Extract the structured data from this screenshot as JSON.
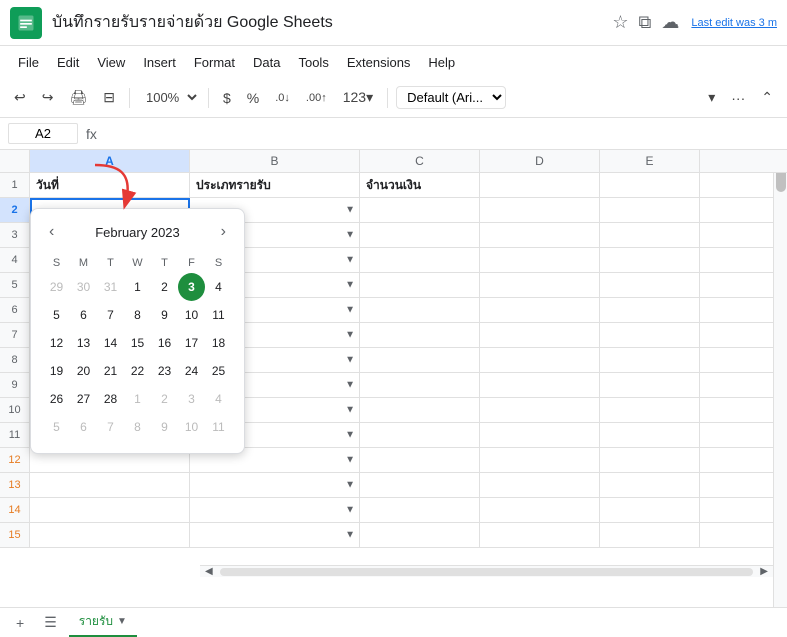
{
  "titleBar": {
    "appName": "บันทึกรายรับรายจ่ายด้วย Google Sheets",
    "lastEdit": "Last edit was 3 m",
    "icons": {
      "star": "☆",
      "copy": "⧉",
      "cloud": "☁"
    }
  },
  "menuBar": {
    "items": [
      "File",
      "Edit",
      "View",
      "Insert",
      "Format",
      "Data",
      "Tools",
      "Extensions",
      "Help"
    ]
  },
  "toolbar": {
    "undo": "↩",
    "redo": "↪",
    "print": "🖨",
    "paintFormat": "⊟",
    "zoom": "100%",
    "currency": "$",
    "percent": "%",
    "decDecrease": ".0",
    "decIncrease": ".00",
    "moreFormats": "123",
    "font": "Default (Ari...",
    "more": "..."
  },
  "formulaBar": {
    "cellRef": "A2",
    "fxLabel": "fx",
    "value": ""
  },
  "columns": {
    "rowHeader": "",
    "headers": [
      "A",
      "B",
      "C",
      "D",
      "E"
    ]
  },
  "rows": [
    {
      "num": "1",
      "numColor": "normal",
      "cells": [
        {
          "text": "วันที่",
          "type": "header",
          "hasDropdown": false
        },
        {
          "text": "ประเภทรายรับ",
          "type": "header",
          "hasDropdown": false
        },
        {
          "text": "จำนวนเงิน",
          "type": "header",
          "hasDropdown": false
        },
        {
          "text": "",
          "type": "normal",
          "hasDropdown": false
        },
        {
          "text": "",
          "type": "normal",
          "hasDropdown": false
        }
      ]
    },
    {
      "num": "2",
      "numColor": "selected",
      "cells": [
        {
          "text": "",
          "type": "selected",
          "hasDropdown": false
        },
        {
          "text": "",
          "type": "normal",
          "hasDropdown": true
        },
        {
          "text": "",
          "type": "normal",
          "hasDropdown": false
        },
        {
          "text": "",
          "type": "normal",
          "hasDropdown": false
        },
        {
          "text": "",
          "type": "normal",
          "hasDropdown": false
        }
      ]
    },
    {
      "num": "3",
      "numColor": "normal",
      "cells": [
        {
          "text": "",
          "type": "normal",
          "hasDropdown": false
        },
        {
          "text": "",
          "type": "normal",
          "hasDropdown": true
        },
        {
          "text": "",
          "type": "normal",
          "hasDropdown": false
        },
        {
          "text": "",
          "type": "normal",
          "hasDropdown": false
        },
        {
          "text": "",
          "type": "normal",
          "hasDropdown": false
        }
      ]
    },
    {
      "num": "4",
      "numColor": "normal",
      "cells": [
        {
          "text": "",
          "type": "normal",
          "hasDropdown": false
        },
        {
          "text": "",
          "type": "normal",
          "hasDropdown": true
        },
        {
          "text": "",
          "type": "normal",
          "hasDropdown": false
        },
        {
          "text": "",
          "type": "normal",
          "hasDropdown": false
        },
        {
          "text": "",
          "type": "normal",
          "hasDropdown": false
        }
      ]
    },
    {
      "num": "5",
      "numColor": "normal",
      "cells": [
        {
          "text": "",
          "type": "normal",
          "hasDropdown": false
        },
        {
          "text": "",
          "type": "normal",
          "hasDropdown": true
        },
        {
          "text": "",
          "type": "normal",
          "hasDropdown": false
        },
        {
          "text": "",
          "type": "normal",
          "hasDropdown": false
        },
        {
          "text": "",
          "type": "normal",
          "hasDropdown": false
        }
      ]
    },
    {
      "num": "6",
      "numColor": "normal",
      "cells": [
        {
          "text": "",
          "type": "normal",
          "hasDropdown": false
        },
        {
          "text": "",
          "type": "normal",
          "hasDropdown": true
        },
        {
          "text": "",
          "type": "normal",
          "hasDropdown": false
        },
        {
          "text": "",
          "type": "normal",
          "hasDropdown": false
        },
        {
          "text": "",
          "type": "normal",
          "hasDropdown": false
        }
      ]
    },
    {
      "num": "7",
      "numColor": "normal",
      "cells": [
        {
          "text": "",
          "type": "normal",
          "hasDropdown": false
        },
        {
          "text": "",
          "type": "normal",
          "hasDropdown": true
        },
        {
          "text": "",
          "type": "normal",
          "hasDropdown": false
        },
        {
          "text": "",
          "type": "normal",
          "hasDropdown": false
        },
        {
          "text": "",
          "type": "normal",
          "hasDropdown": false
        }
      ]
    },
    {
      "num": "8",
      "numColor": "normal",
      "cells": [
        {
          "text": "",
          "type": "normal",
          "hasDropdown": false
        },
        {
          "text": "",
          "type": "normal",
          "hasDropdown": true
        },
        {
          "text": "",
          "type": "normal",
          "hasDropdown": false
        },
        {
          "text": "",
          "type": "normal",
          "hasDropdown": false
        },
        {
          "text": "",
          "type": "normal",
          "hasDropdown": false
        }
      ]
    },
    {
      "num": "9",
      "numColor": "normal",
      "cells": [
        {
          "text": "",
          "type": "normal",
          "hasDropdown": false
        },
        {
          "text": "",
          "type": "normal",
          "hasDropdown": true
        },
        {
          "text": "",
          "type": "normal",
          "hasDropdown": false
        },
        {
          "text": "",
          "type": "normal",
          "hasDropdown": false
        },
        {
          "text": "",
          "type": "normal",
          "hasDropdown": false
        }
      ]
    },
    {
      "num": "10",
      "numColor": "normal",
      "cells": [
        {
          "text": "",
          "type": "normal",
          "hasDropdown": false
        },
        {
          "text": "",
          "type": "normal",
          "hasDropdown": true
        },
        {
          "text": "",
          "type": "normal",
          "hasDropdown": false
        },
        {
          "text": "",
          "type": "normal",
          "hasDropdown": false
        },
        {
          "text": "",
          "type": "normal",
          "hasDropdown": false
        }
      ]
    },
    {
      "num": "11",
      "numColor": "normal",
      "cells": [
        {
          "text": "",
          "type": "normal",
          "hasDropdown": false
        },
        {
          "text": "",
          "type": "normal",
          "hasDropdown": true
        },
        {
          "text": "",
          "type": "normal",
          "hasDropdown": false
        },
        {
          "text": "",
          "type": "normal",
          "hasDropdown": false
        },
        {
          "text": "",
          "type": "normal",
          "hasDropdown": false
        }
      ]
    },
    {
      "num": "12",
      "numColor": "orange",
      "cells": [
        {
          "text": "",
          "type": "normal",
          "hasDropdown": false
        },
        {
          "text": "",
          "type": "normal",
          "hasDropdown": true
        },
        {
          "text": "",
          "type": "normal",
          "hasDropdown": false
        },
        {
          "text": "",
          "type": "normal",
          "hasDropdown": false
        },
        {
          "text": "",
          "type": "normal",
          "hasDropdown": false
        }
      ]
    },
    {
      "num": "13",
      "numColor": "orange",
      "cells": [
        {
          "text": "",
          "type": "normal",
          "hasDropdown": false
        },
        {
          "text": "",
          "type": "normal",
          "hasDropdown": true
        },
        {
          "text": "",
          "type": "normal",
          "hasDropdown": false
        },
        {
          "text": "",
          "type": "normal",
          "hasDropdown": false
        },
        {
          "text": "",
          "type": "normal",
          "hasDropdown": false
        }
      ]
    },
    {
      "num": "14",
      "numColor": "orange",
      "cells": [
        {
          "text": "",
          "type": "normal",
          "hasDropdown": false
        },
        {
          "text": "",
          "type": "normal",
          "hasDropdown": true
        },
        {
          "text": "",
          "type": "normal",
          "hasDropdown": false
        },
        {
          "text": "",
          "type": "normal",
          "hasDropdown": false
        },
        {
          "text": "",
          "type": "normal",
          "hasDropdown": false
        }
      ]
    },
    {
      "num": "15",
      "numColor": "orange",
      "cells": [
        {
          "text": "",
          "type": "normal",
          "hasDropdown": false
        },
        {
          "text": "",
          "type": "normal",
          "hasDropdown": true
        },
        {
          "text": "",
          "type": "normal",
          "hasDropdown": false
        },
        {
          "text": "",
          "type": "normal",
          "hasDropdown": false
        },
        {
          "text": "",
          "type": "normal",
          "hasDropdown": false
        }
      ]
    }
  ],
  "calendar": {
    "monthYear": "February 2023",
    "dayHeaders": [
      "S",
      "M",
      "T",
      "W",
      "T",
      "F",
      "S"
    ],
    "weeks": [
      [
        {
          "day": "29",
          "type": "other"
        },
        {
          "day": "30",
          "type": "other"
        },
        {
          "day": "31",
          "type": "other"
        },
        {
          "day": "1",
          "type": "normal"
        },
        {
          "day": "2",
          "type": "normal"
        },
        {
          "day": "3",
          "type": "today"
        },
        {
          "day": "4",
          "type": "normal"
        }
      ],
      [
        {
          "day": "5",
          "type": "normal"
        },
        {
          "day": "6",
          "type": "normal"
        },
        {
          "day": "7",
          "type": "normal"
        },
        {
          "day": "8",
          "type": "normal"
        },
        {
          "day": "9",
          "type": "normal"
        },
        {
          "day": "10",
          "type": "normal"
        },
        {
          "day": "11",
          "type": "normal"
        }
      ],
      [
        {
          "day": "12",
          "type": "normal"
        },
        {
          "day": "13",
          "type": "normal"
        },
        {
          "day": "14",
          "type": "normal"
        },
        {
          "day": "15",
          "type": "normal"
        },
        {
          "day": "16",
          "type": "normal"
        },
        {
          "day": "17",
          "type": "normal"
        },
        {
          "day": "18",
          "type": "normal"
        }
      ],
      [
        {
          "day": "19",
          "type": "normal"
        },
        {
          "day": "20",
          "type": "normal"
        },
        {
          "day": "21",
          "type": "normal"
        },
        {
          "day": "22",
          "type": "normal"
        },
        {
          "day": "23",
          "type": "normal"
        },
        {
          "day": "24",
          "type": "normal"
        },
        {
          "day": "25",
          "type": "normal"
        }
      ],
      [
        {
          "day": "26",
          "type": "normal"
        },
        {
          "day": "27",
          "type": "normal"
        },
        {
          "day": "28",
          "type": "normal"
        },
        {
          "day": "1",
          "type": "other"
        },
        {
          "day": "2",
          "type": "other"
        },
        {
          "day": "3",
          "type": "other"
        },
        {
          "day": "4",
          "type": "other"
        }
      ],
      [
        {
          "day": "5",
          "type": "other"
        },
        {
          "day": "6",
          "type": "other"
        },
        {
          "day": "7",
          "type": "other"
        },
        {
          "day": "8",
          "type": "other"
        },
        {
          "day": "9",
          "type": "other"
        },
        {
          "day": "10",
          "type": "other"
        },
        {
          "day": "11",
          "type": "other"
        }
      ]
    ]
  },
  "sheetTabs": {
    "addBtn": "+",
    "listBtn": "☰",
    "activeTab": "รายรับ",
    "tabArrow": "▼"
  }
}
